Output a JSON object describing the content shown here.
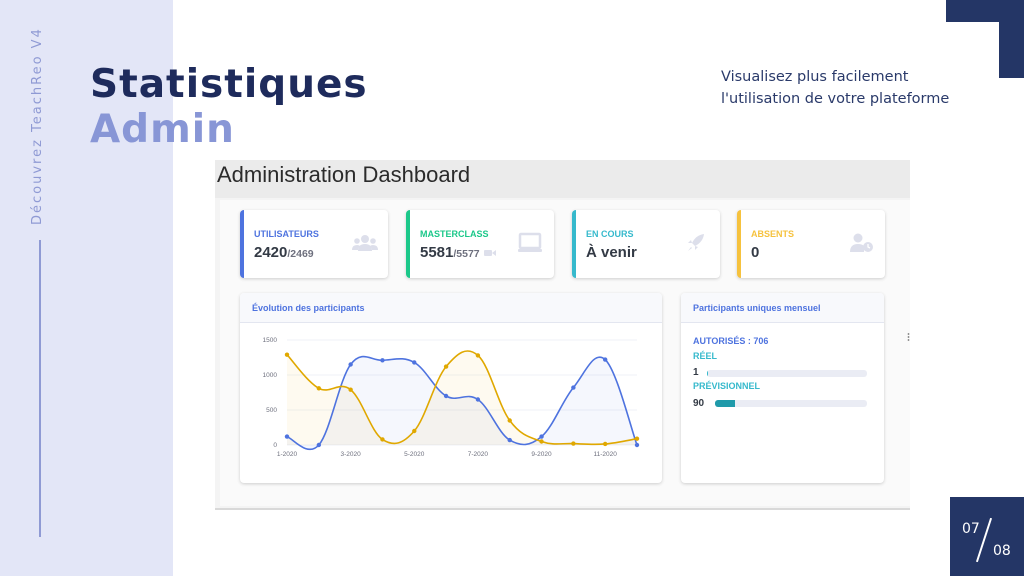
{
  "slide": {
    "side_label": "Découvrez TeachReo V4",
    "title_line1": "Statistiques",
    "title_line2": "Admin",
    "subtitle": "Visualisez plus facilement l'utilisation de votre plateforme",
    "page_current": "07",
    "page_total": "08"
  },
  "dashboard": {
    "title": "Administration Dashboard",
    "cards": [
      {
        "label": "UTILISATEURS",
        "value": "2420",
        "sub": "/2469",
        "icon": "users-icon",
        "color": "#4e73df"
      },
      {
        "label": "MASTERCLASS",
        "value": "5581",
        "sub": "/5577",
        "icon": "video-icon",
        "color": "#1cc88a"
      },
      {
        "label": "EN COURS",
        "value": "À venir",
        "sub": "",
        "icon": "rocket-icon",
        "color": "#36b9cc"
      },
      {
        "label": "ABSENTS",
        "value": "0",
        "sub": "",
        "icon": "user-clock-icon",
        "color": "#f6c23e"
      }
    ],
    "evolution_panel": {
      "title": "Évolution des participants"
    },
    "unique_panel": {
      "title": "Participants uniques mensuel",
      "authorized_label": "AUTORISÉS : 706",
      "real_label": "RÉEL",
      "real_value": "1",
      "real_progress": 0.005,
      "forecast_label": "PRÉVISIONNEL",
      "forecast_value": "90",
      "forecast_progress": 0.13
    }
  },
  "chart_data": {
    "type": "line",
    "x": [
      "1-2020",
      "2-2020",
      "3-2020",
      "4-2020",
      "5-2020",
      "6-2020",
      "7-2020",
      "8-2020",
      "9-2020",
      "10-2020",
      "11-2020",
      "12-2020"
    ],
    "tick_labels": [
      "1-2020",
      "3-2020",
      "5-2020",
      "7-2020",
      "9-2020",
      "11-2020"
    ],
    "ylim": [
      0,
      1500
    ],
    "yticks": [
      0,
      500,
      1000,
      1500
    ],
    "series": [
      {
        "color": "#4e73df",
        "values": [
          120,
          0,
          1150,
          1210,
          1180,
          700,
          650,
          70,
          120,
          820,
          1220,
          0
        ]
      },
      {
        "color": "#e0a800",
        "values": [
          1290,
          810,
          790,
          80,
          200,
          1120,
          1280,
          350,
          50,
          20,
          15,
          90
        ]
      }
    ],
    "grid": true
  }
}
